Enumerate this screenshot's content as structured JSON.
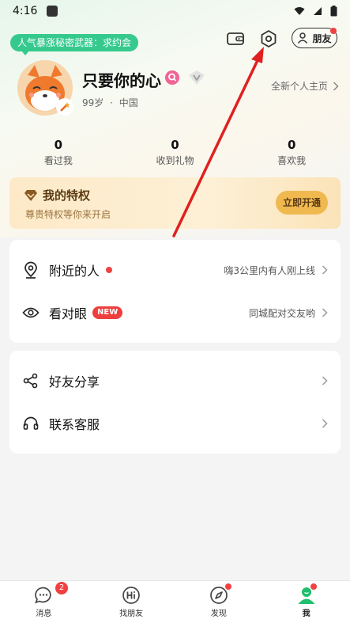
{
  "status_bar": {
    "time": "4:16"
  },
  "header": {
    "tag_pill": "人气暴涨秘密武器：求约会",
    "friends_button": "朋友"
  },
  "profile": {
    "username": "只要你的心",
    "age": "99岁",
    "separator": "·",
    "country": "中国",
    "homepage_link": "全新个人主页"
  },
  "stats": [
    {
      "value": "0",
      "label": "看过我"
    },
    {
      "value": "0",
      "label": "收到礼物"
    },
    {
      "value": "0",
      "label": "喜欢我"
    }
  ],
  "vip": {
    "title": "我的特权",
    "subtitle": "尊贵特权等你来开启",
    "button": "立即开通"
  },
  "menu_group_1": [
    {
      "title": "附近的人",
      "hint": "嗨3公里内有人刚上线",
      "icon": "location-pin-icon"
    },
    {
      "title": "看对眼",
      "badge": "NEW",
      "hint": "同城配对交友哟",
      "icon": "eye-icon"
    }
  ],
  "menu_group_2": [
    {
      "title": "好友分享",
      "icon": "share-icon"
    },
    {
      "title": "联系客服",
      "icon": "headset-icon"
    }
  ],
  "tabbar": [
    {
      "label": "消息",
      "badge": "2",
      "icon": "chat-bubble-icon"
    },
    {
      "label": "找朋友",
      "icon": "hi-icon"
    },
    {
      "label": "发现",
      "icon": "compass-icon"
    },
    {
      "label": "我",
      "icon": "person-icon"
    }
  ],
  "colors": {
    "accent_green": "#36c98e",
    "alert_red": "#f04141",
    "vip_gold": "#f0b950",
    "annotation_arrow": "#e02020"
  }
}
